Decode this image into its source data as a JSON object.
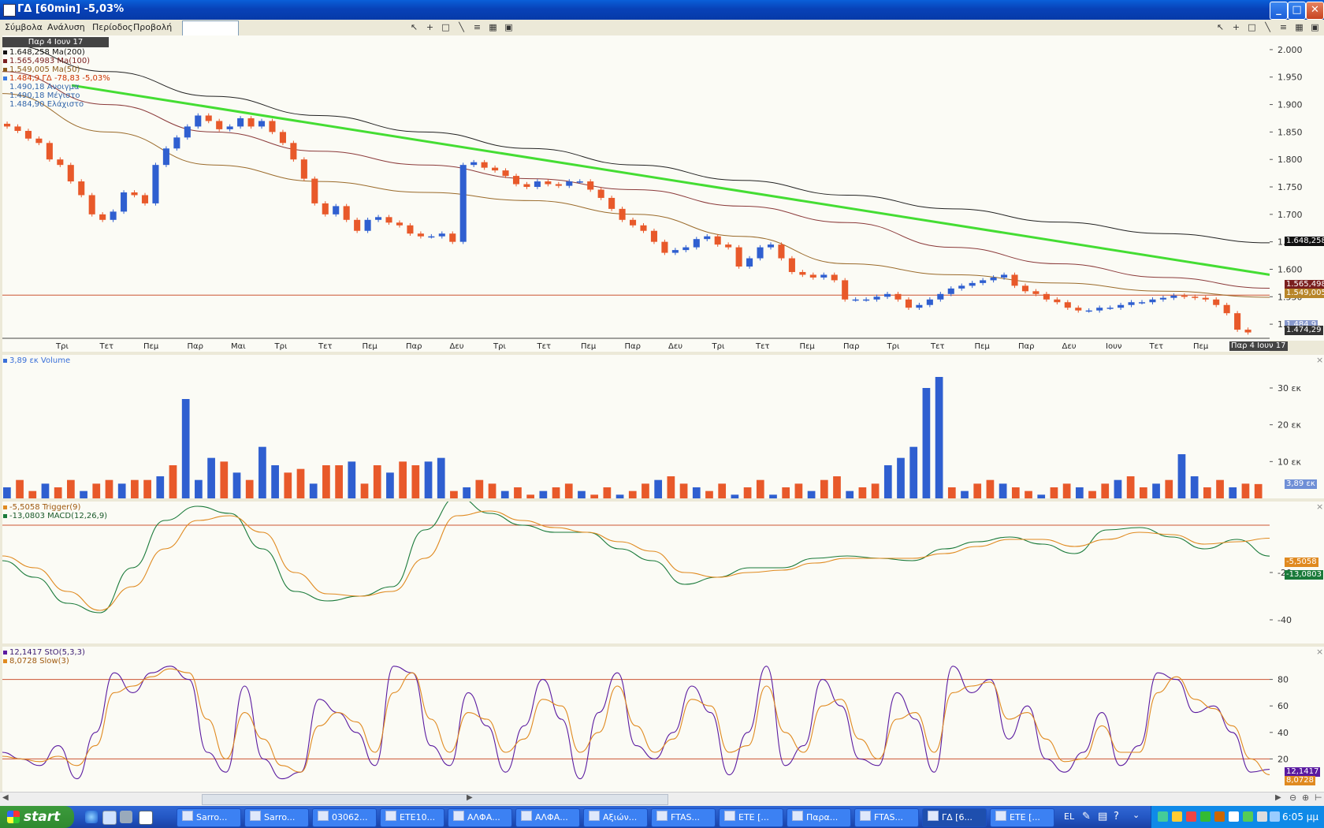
{
  "window": {
    "title": "ΓΔ [60min] -5,03%"
  },
  "menu": [
    "Σύμβολα",
    "Ανάλυση",
    "Περίοδος",
    "Προβολή"
  ],
  "toolbar": {
    "symbol_input_value": ""
  },
  "price_pane": {
    "date_badge": "Παρ 4 Ιουν 17",
    "legend": [
      {
        "text": "1.648,258 Ma(200)",
        "color": "#111111"
      },
      {
        "text": "1.565,4983 Ma(100)",
        "color": "#7a1f1f"
      },
      {
        "text": "1.549,005 Ma(50)",
        "color": "#8a5a1a"
      },
      {
        "text": "1.484,9 ΓΔ -78,83 -5,03%",
        "color": "#cc3300"
      },
      {
        "text": "1.490,18 Ανοιγμα",
        "color": "#3366aa"
      },
      {
        "text": "1.490,18 Μέγιστο",
        "color": "#3366aa"
      },
      {
        "text": "1.484,90 Ελάχιστο",
        "color": "#3366aa"
      }
    ],
    "y_ticks": [
      "2.000",
      "1.950",
      "1.900",
      "1.850",
      "1.800",
      "1.750",
      "1.700",
      "1.650",
      "1.600",
      "1.550",
      "1.500"
    ],
    "price_boxes": [
      {
        "text": "1.648,258",
        "bg": "#111111",
        "value": 1648.258
      },
      {
        "text": "1.565,498",
        "bg": "#7a1f1f",
        "value": 1565.498
      },
      {
        "text": "1.549,005",
        "bg": "#b8862a",
        "value": 1549.005
      },
      {
        "text": "1.484,9",
        "bg": "#8899cc",
        "value": 1484.9
      },
      {
        "text": "1.474,29",
        "bg": "#333333",
        "value": 1474.29
      }
    ],
    "x_labels": [
      "Τρι",
      "Τετ",
      "Πεμ",
      "Παρ",
      "Μαι",
      "Τρι",
      "Τετ",
      "Πεμ",
      "Παρ",
      "Δευ",
      "Τρι",
      "Τετ",
      "Πεμ",
      "Παρ",
      "Δευ",
      "Τρι",
      "Τετ",
      "Πεμ",
      "Παρ",
      "Τρι",
      "Τετ",
      "Πεμ",
      "Παρ",
      "Δευ",
      "Ιουν",
      "Τετ",
      "Πεμ",
      "Π"
    ],
    "crosshair_date": "Παρ 4 Ιουν 17"
  },
  "volume_pane": {
    "legend": "3,89 εκ Volume",
    "y_ticks": [
      "30 εκ",
      "20 εκ",
      "10 εκ"
    ],
    "current_box": "3,89 εκ"
  },
  "macd_pane": {
    "legend": [
      {
        "text": "-5,5058 Trigger(9)",
        "color": "#e08a20"
      },
      {
        "text": "-13,0803 MACD(12,26,9)",
        "color": "#1a7a3a"
      }
    ],
    "y_ticks": [
      "-20",
      "-40"
    ],
    "boxes": [
      {
        "text": "-5,5058",
        "bg": "#e08a20"
      },
      {
        "text": "-13,0803",
        "bg": "#1a7a3a"
      }
    ]
  },
  "stoch_pane": {
    "legend": [
      {
        "text": "12,1417 StO(5,3,3)",
        "color": "#5a1aa0"
      },
      {
        "text": "8,0728 Slow(3)",
        "color": "#e08a20"
      }
    ],
    "y_ticks": [
      "80",
      "60",
      "40",
      "20"
    ],
    "boxes": [
      {
        "text": "12,1417",
        "bg": "#5a1aa0"
      },
      {
        "text": "8,0728",
        "bg": "#e08a20"
      }
    ]
  },
  "taskbar": {
    "start_label": "start",
    "tasks": [
      "Sarro...",
      "Sarro...",
      "03062...",
      "ETE10...",
      "ΑΛΦΑ...",
      "ΑΛΦΑ...",
      "Αξιών...",
      "FTAS...",
      "ETE [...",
      "Παρα...",
      "FTAS...",
      "ΓΔ [6...",
      "ETE [..."
    ],
    "active_task_index": 11,
    "language": "EL",
    "clock": "6:05 μμ"
  },
  "chart_data": [
    {
      "type": "candlestick",
      "title": "ΓΔ [60min] -5,03%",
      "ylim": [
        1470,
        2020
      ],
      "series": [
        {
          "name": "ΓΔ",
          "close_values": [
            1860,
            1852,
            1838,
            1830,
            1800,
            1790,
            1760,
            1735,
            1700,
            1690,
            1705,
            1740,
            1735,
            1720,
            1790,
            1820,
            1840,
            1860,
            1880,
            1870,
            1855,
            1860,
            1875,
            1860,
            1870,
            1850,
            1830,
            1800,
            1765,
            1720,
            1700,
            1715,
            1690,
            1670,
            1690,
            1695,
            1685,
            1680,
            1665,
            1660,
            1660,
            1665,
            1650,
            1790,
            1795,
            1785,
            1780,
            1770,
            1755,
            1750,
            1760,
            1755,
            1752,
            1760,
            1760,
            1745,
            1730,
            1710,
            1690,
            1680,
            1670,
            1650,
            1630,
            1635,
            1640,
            1655,
            1660,
            1645,
            1640,
            1605,
            1620,
            1640,
            1645,
            1620,
            1595,
            1590,
            1585,
            1590,
            1580,
            1545,
            1545,
            1545,
            1550,
            1555,
            1545,
            1530,
            1535,
            1545,
            1555,
            1565,
            1570,
            1575,
            1580,
            1585,
            1590,
            1570,
            1560,
            1555,
            1545,
            1540,
            1530,
            1525,
            1525,
            1530,
            1530,
            1535,
            1540,
            1540,
            1545,
            1548,
            1552,
            1550,
            1548,
            1545,
            1535,
            1520,
            1490,
            1485
          ]
        },
        {
          "name": "Ma(200)",
          "values": [
            2010,
            1960,
            1915,
            1880,
            1850,
            1820,
            1790,
            1762,
            1735,
            1710,
            1686,
            1665,
            1648.258
          ]
        },
        {
          "name": "Ma(100)",
          "values": [
            1960,
            1900,
            1850,
            1815,
            1790,
            1765,
            1745,
            1715,
            1685,
            1640,
            1610,
            1585,
            1565.498
          ]
        },
        {
          "name": "Ma(50)",
          "values": [
            1920,
            1850,
            1790,
            1760,
            1740,
            1725,
            1700,
            1660,
            1610,
            1590,
            1575,
            1560,
            1549.005
          ]
        }
      ],
      "annotations": [
        {
          "type": "trendline",
          "color": "#44dd33",
          "from": 1935,
          "to": 1590
        },
        {
          "type": "horizontal_line",
          "value": 1553,
          "color": "#cc5533"
        },
        {
          "type": "horizontal_line",
          "value": 1474.29,
          "color": "#444444"
        }
      ]
    },
    {
      "type": "bar",
      "title": "3,89 εκ Volume",
      "ylim": [
        0,
        36
      ],
      "series": [
        {
          "name": "Volume",
          "values": [
            3,
            5,
            2,
            4,
            3,
            5,
            2,
            4,
            5,
            4,
            5,
            5,
            6,
            9,
            27,
            5,
            11,
            10,
            7,
            5,
            14,
            9,
            7,
            8,
            4,
            9,
            9,
            10,
            4,
            9,
            7,
            10,
            9,
            10,
            11,
            2,
            3,
            5,
            4,
            2,
            3,
            1,
            2,
            3,
            4,
            2,
            1,
            3,
            1,
            2,
            4,
            5,
            6,
            4,
            3,
            2,
            4,
            1,
            3,
            5,
            1,
            3,
            4,
            2,
            5,
            6,
            2,
            3,
            4,
            9,
            11,
            14,
            30,
            33,
            3,
            2,
            4,
            5,
            4,
            3,
            2,
            1,
            3,
            4,
            3,
            2,
            4,
            5,
            6,
            3,
            4,
            5,
            12,
            6,
            3,
            5,
            3,
            4,
            3.89
          ]
        }
      ]
    },
    {
      "type": "line",
      "title": "MACD(12,26,9)",
      "ylim": [
        -50,
        10
      ],
      "series": [
        {
          "name": "MACD(12,26,9)",
          "values": [
            -15,
            -22,
            -33,
            -37,
            -18,
            2,
            8,
            5,
            -10,
            -28,
            -32,
            -30,
            -26,
            -2,
            12,
            5,
            0,
            -3,
            -3,
            -10,
            -15,
            -25,
            -22,
            -18,
            -18,
            -14,
            -13,
            -14,
            -15,
            -10,
            -7,
            -5,
            -8,
            -12,
            -2,
            -1,
            -5,
            -10,
            -6,
            -13.0803
          ]
        },
        {
          "name": "Trigger(9)",
          "values": [
            -13,
            -18,
            -28,
            -36,
            -26,
            -10,
            2,
            4,
            -3,
            -20,
            -29,
            -30,
            -28,
            -14,
            4,
            6,
            2,
            -1,
            -3,
            -7,
            -11,
            -20,
            -22,
            -20,
            -19,
            -16,
            -14,
            -14,
            -14,
            -12,
            -9,
            -6,
            -6,
            -9,
            -6,
            -3,
            -4,
            -8,
            -7,
            -5.5058
          ]
        }
      ]
    },
    {
      "type": "line",
      "title": "StO(5,3,3)",
      "ylim": [
        0,
        100
      ],
      "series": [
        {
          "name": "StO(5,3,3)",
          "values": [
            25,
            20,
            15,
            30,
            5,
            40,
            85,
            70,
            85,
            90,
            80,
            25,
            10,
            75,
            20,
            5,
            10,
            65,
            55,
            40,
            15,
            90,
            85,
            30,
            15,
            70,
            45,
            10,
            45,
            80,
            50,
            5,
            55,
            85,
            30,
            20,
            40,
            75,
            55,
            8,
            40,
            90,
            15,
            30,
            80,
            60,
            20,
            15,
            70,
            50,
            10,
            90,
            70,
            80,
            35,
            60,
            20,
            10,
            25,
            55,
            15,
            30,
            85,
            80,
            55,
            60,
            40,
            10,
            12.1417
          ]
        },
        {
          "name": "Slow(3)",
          "values": [
            22,
            20,
            18,
            22,
            15,
            30,
            70,
            75,
            82,
            88,
            85,
            50,
            20,
            55,
            35,
            15,
            10,
            45,
            55,
            48,
            25,
            70,
            85,
            50,
            25,
            55,
            50,
            25,
            35,
            65,
            60,
            25,
            40,
            75,
            45,
            25,
            35,
            65,
            60,
            25,
            30,
            75,
            40,
            25,
            60,
            65,
            35,
            20,
            50,
            55,
            25,
            70,
            75,
            78,
            50,
            55,
            35,
            18,
            20,
            45,
            25,
            25,
            70,
            82,
            65,
            58,
            45,
            20,
            8.0728
          ]
        }
      ]
    }
  ]
}
